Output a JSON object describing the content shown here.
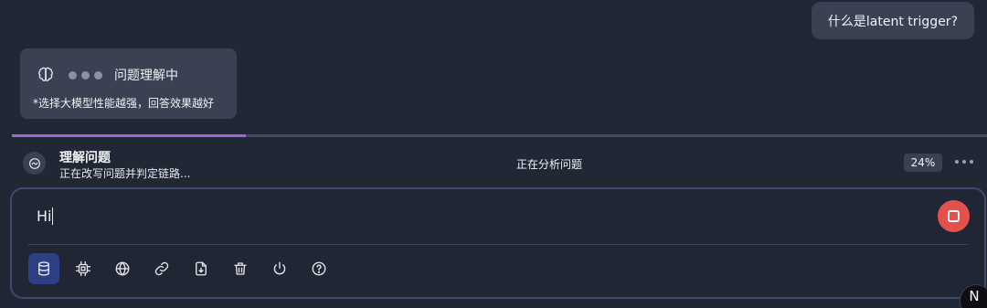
{
  "user_message": "什么是latent trigger?",
  "thinking": {
    "title": "问题理解中",
    "note": "*选择大模型性能越强，回答效果越好"
  },
  "progress": {
    "fraction": 0.24
  },
  "status": {
    "title": "理解问题",
    "subtitle": "正在改写问题并判定链路...",
    "center": "正在分析问题",
    "percent": "24%"
  },
  "input": {
    "value": "Hi"
  },
  "toolbar": {
    "tools": [
      {
        "icon": "database-icon",
        "active": true
      },
      {
        "icon": "chip-icon",
        "active": false
      },
      {
        "icon": "globe-icon",
        "active": false
      },
      {
        "icon": "link-icon",
        "active": false
      },
      {
        "icon": "file-download-icon",
        "active": false
      },
      {
        "icon": "trash-icon",
        "active": false
      },
      {
        "icon": "power-icon",
        "active": false
      },
      {
        "icon": "help-circle-icon",
        "active": false
      }
    ]
  },
  "corner_badge": "N",
  "colors": {
    "accent": "#9b6ad8",
    "stop": "#e4514d",
    "active_tool": "#2f3f86"
  }
}
